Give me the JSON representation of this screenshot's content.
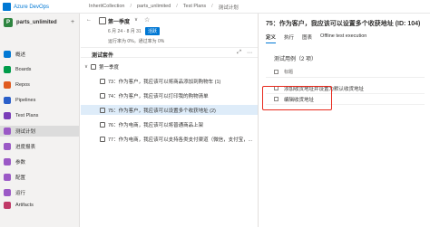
{
  "header": {
    "brand": "Azure DevOps",
    "breadcrumbs": [
      "InheritCollection",
      "parts_unlimited",
      "Test Plans",
      "测试计划"
    ]
  },
  "sidebar": {
    "project_initial": "P",
    "project_name": "parts_unlimited",
    "add_label": "+",
    "items": [
      {
        "label": "概述",
        "icon_color": "#0078d4"
      },
      {
        "label": "Boards",
        "icon_color": "#009c4a"
      },
      {
        "label": "Repos",
        "icon_color": "#e05b1f"
      },
      {
        "label": "Pipelines",
        "icon_color": "#2a5fc9"
      },
      {
        "label": "Test Plans",
        "icon_color": "#7a3db8"
      },
      {
        "label": "测试计划",
        "icon_color": "#9b59c6"
      },
      {
        "label": "进度报表",
        "icon_color": "#9b59c6"
      },
      {
        "label": "参数",
        "icon_color": "#9b59c6"
      },
      {
        "label": "配置",
        "icon_color": "#9b59c6"
      },
      {
        "label": "运行",
        "icon_color": "#9b59c6"
      },
      {
        "label": "Artifacts",
        "icon_color": "#c03967"
      }
    ]
  },
  "plan": {
    "back_icon": "←",
    "title": "第一季度",
    "chevron": "∨",
    "star": "☆",
    "dates": "6 月 24 - 8 月 31",
    "status": "活跃",
    "progress": "运行率为 0%。通过率为 0%"
  },
  "suites": {
    "title": "测试套件",
    "tools": [
      "⤢",
      "⋯"
    ],
    "items": [
      {
        "label": "第一季度",
        "level": 0,
        "chevron": "∨"
      },
      {
        "label": "73：作为客户，我应该可以将商品添加到购物车 (1)",
        "level": 1,
        "chevron": ""
      },
      {
        "label": "74：作为客户，我应该可以打印我的购物清单",
        "level": 1,
        "chevron": ""
      },
      {
        "label": "75：作为客户，我应该可以设置多个收获地址 (2)",
        "level": 1,
        "chevron": "",
        "selected": true
      },
      {
        "label": "76：作为电商，我应该可以将普通商品上架",
        "level": 1,
        "chevron": ""
      },
      {
        "label": "77：作为电商，我应该可以支持各类支付渠道（微信，支付宝，...",
        "level": 1,
        "chevron": ""
      }
    ]
  },
  "detail": {
    "title": "75：作为客户，我应该可以设置多个收获地址 (ID: 104)",
    "tabs": [
      "定义",
      "执行",
      "图表",
      "Offline test execution"
    ],
    "cases_title": "测试用例（2 项）",
    "column_header": "标题",
    "cases": [
      "添加收货地址并设置为默认收货地址",
      "编辑收货地址"
    ]
  },
  "colors": {
    "accent": "#0078d4",
    "highlight": "#e8291c",
    "selected_row": "#deecf9"
  }
}
